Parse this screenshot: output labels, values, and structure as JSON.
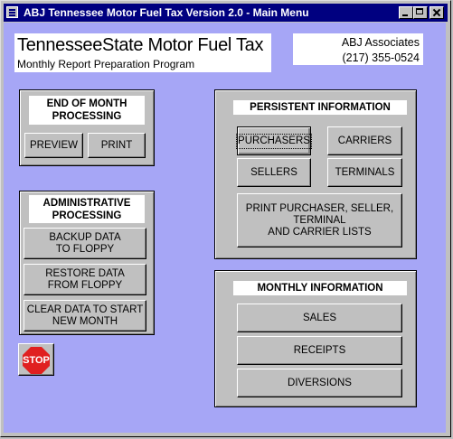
{
  "window": {
    "title": "ABJ Tennessee Motor Fuel Tax Version 2.0 -  Main Menu"
  },
  "header": {
    "title": "TennesseeState Motor Fuel Tax",
    "subtitle": "Monthly Report Preparation Program",
    "company": "ABJ Associates",
    "phone": "(217) 355-0524"
  },
  "end_of_month": {
    "title": "END OF MONTH\nPROCESSING",
    "preview": "PREVIEW",
    "print": "PRINT"
  },
  "administrative": {
    "title": "ADMINISTRATIVE\nPROCESSING",
    "backup": "BACKUP DATA\nTO FLOPPY",
    "restore": "RESTORE DATA\nFROM FLOPPY",
    "clear": "CLEAR DATA TO START\nNEW MONTH"
  },
  "persistent": {
    "title": "PERSISTENT INFORMATION",
    "purchasers": "PURCHASERS",
    "carriers": "CARRIERS",
    "sellers": "SELLERS",
    "terminals": "TERMINALS",
    "print_lists": "PRINT PURCHASER, SELLER,\nTERMINAL\nAND CARRIER  LISTS"
  },
  "monthly": {
    "title": "MONTHLY INFORMATION",
    "sales": "SALES",
    "receipts": "RECEIPTS",
    "diversions": "DIVERSIONS"
  },
  "stop": {
    "label": "STOP",
    "color": "#e02020"
  },
  "colors": {
    "background": "#a6a6f6",
    "titlebar": "#000080",
    "panel": "#c0c0c0"
  }
}
